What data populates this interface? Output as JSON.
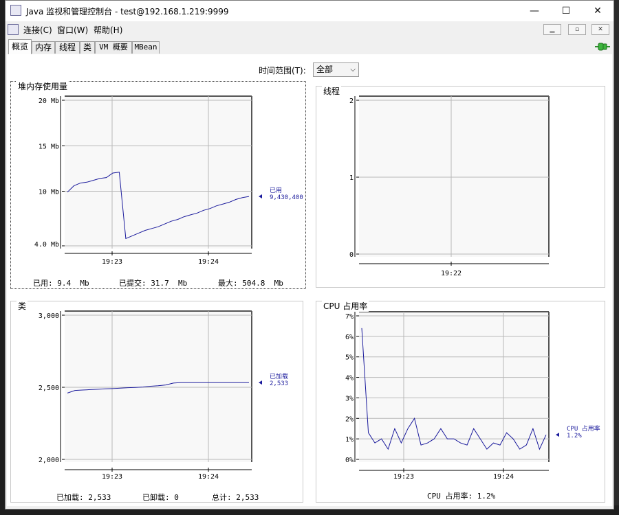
{
  "window": {
    "title": "Java 监视和管理控制台 - test@192.168.1.219:9999",
    "buttons": {
      "minimize": "—",
      "maximize": "☐",
      "close": "✕"
    }
  },
  "menu": {
    "items": [
      "连接(C)",
      "窗口(W)",
      "帮助(H)"
    ],
    "mdi_buttons": [
      "▁",
      "▫",
      "✕"
    ]
  },
  "tabs": [
    "概览",
    "内存",
    "线程",
    "类",
    "VM 概要",
    "MBean"
  ],
  "active_tab": "概览",
  "time_range": {
    "label": "时间范围(T):",
    "value": "全部"
  },
  "colors": {
    "series": "#1a1a9c",
    "plot_bg": "#f8f8f8",
    "grid": "#b8b8b8"
  },
  "chart_data": [
    {
      "id": "heap",
      "type": "line",
      "title": "堆内存使用量",
      "yticks": [
        "20 Mb",
        "15 Mb",
        "10 Mb",
        "4.0 Mb"
      ],
      "ytick_values": [
        20,
        15,
        10,
        4.0
      ],
      "ylim": [
        4.0,
        20
      ],
      "xticks": [
        "19:23",
        "19:24"
      ],
      "series": [
        {
          "name": "已用",
          "values": [
            9.9,
            10.6,
            10.9,
            11.0,
            11.2,
            11.4,
            11.5,
            12.0,
            12.1,
            4.8,
            5.1,
            5.4,
            5.7,
            5.9,
            6.1,
            6.4,
            6.7,
            6.9,
            7.2,
            7.4,
            7.6,
            7.9,
            8.1,
            8.4,
            8.6,
            8.8,
            9.1,
            9.3,
            9.43
          ]
        }
      ],
      "current_label": "已用",
      "current_value": "9,430,400",
      "stats": {
        "used_label": "已用:",
        "used": "9.4  Mb",
        "committed_label": "已提交:",
        "committed": "31.7  Mb",
        "max_label": "最大:",
        "max": "504.8  Mb"
      }
    },
    {
      "id": "threads",
      "type": "line",
      "title": "线程",
      "yticks": [
        "2",
        "1",
        "0"
      ],
      "ytick_values": [
        2,
        1,
        0
      ],
      "ylim": [
        0,
        2
      ],
      "xticks": [
        "19:22"
      ],
      "series": []
    },
    {
      "id": "classes",
      "type": "line",
      "title": "类",
      "yticks": [
        "3,000",
        "2,500",
        "2,000"
      ],
      "ytick_values": [
        3000,
        2500,
        2000
      ],
      "ylim": [
        2000,
        3000
      ],
      "xticks": [
        "19:23",
        "19:24"
      ],
      "series": [
        {
          "name": "已加载",
          "values": [
            2460,
            2478,
            2481,
            2484,
            2486,
            2489,
            2491,
            2494,
            2497,
            2499,
            2502,
            2507,
            2511,
            2516,
            2529,
            2533,
            2533,
            2533,
            2533,
            2533,
            2533,
            2533,
            2533,
            2533,
            2533
          ]
        }
      ],
      "current_label": "已加载",
      "current_value": "2,533",
      "stats": {
        "loaded_label": "已加载:",
        "loaded": "2,533",
        "unloaded_label": "已卸载:",
        "unloaded": "0",
        "total_label": "总计:",
        "total": "2,533"
      }
    },
    {
      "id": "cpu",
      "type": "line",
      "title": "CPU 占用率",
      "yticks": [
        "7%",
        "6%",
        "5%",
        "4%",
        "3%",
        "2%",
        "1%",
        "0%"
      ],
      "ytick_values": [
        7,
        6,
        5,
        4,
        3,
        2,
        1,
        0
      ],
      "ylim": [
        0,
        7
      ],
      "xticks": [
        "19:23",
        "19:24"
      ],
      "series": [
        {
          "name": "CPU 占用率",
          "values": [
            6.4,
            1.3,
            0.8,
            1.0,
            0.5,
            1.5,
            0.8,
            1.5,
            2.0,
            0.7,
            0.8,
            1.0,
            1.5,
            1.0,
            1.0,
            0.8,
            0.7,
            1.5,
            1.0,
            0.5,
            0.8,
            0.7,
            1.3,
            1.0,
            0.5,
            0.7,
            1.5,
            0.5,
            1.2
          ]
        }
      ],
      "current_label": "CPU 占用率",
      "current_value": "1.2%",
      "stats": {
        "cpu_label": "CPU 占用率:",
        "cpu": "1.2%"
      }
    }
  ]
}
